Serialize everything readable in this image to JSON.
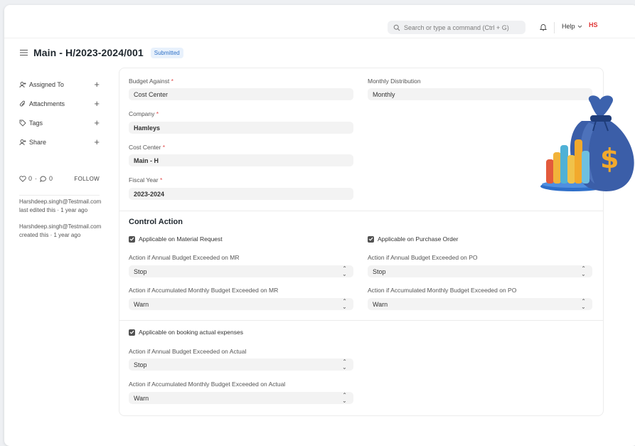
{
  "topbar": {
    "search_placeholder": "Search or type a command (Ctrl + G)",
    "help_label": "Help",
    "avatar_initials": "HS"
  },
  "page": {
    "title": "Main - H/2023-2024/001",
    "status_badge": "Submitted"
  },
  "sidebar": {
    "items": [
      {
        "label": "Assigned To",
        "icon": "user-plus-icon"
      },
      {
        "label": "Attachments",
        "icon": "paperclip-icon"
      },
      {
        "label": "Tags",
        "icon": "tag-icon"
      },
      {
        "label": "Share",
        "icon": "share-user-icon"
      }
    ],
    "likes": "0",
    "comments": "0",
    "separator": "·",
    "follow_label": "FOLLOW",
    "activity": [
      {
        "user": "Harshdeep.singh@Testmail.com",
        "text": "last edited this · 1 year ago"
      },
      {
        "user": "Harshdeep.singh@Testmail.com",
        "text": "created this · 1 year ago"
      }
    ]
  },
  "form": {
    "budget_against": {
      "label": "Budget Against",
      "value": "Cost Center"
    },
    "company": {
      "label": "Company",
      "value": "Hamleys"
    },
    "cost_center": {
      "label": "Cost Center",
      "value": "Main - H"
    },
    "fiscal_year": {
      "label": "Fiscal Year",
      "value": "2023-2024"
    },
    "monthly_distribution": {
      "label": "Monthly Distribution",
      "value": "Monthly"
    },
    "required_mark": "*",
    "control_action": {
      "title": "Control Action",
      "applicable_mr": "Applicable on Material Request",
      "applicable_po": "Applicable on Purchase Order",
      "annual_mr": {
        "label": "Action if Annual Budget Exceeded on MR",
        "value": "Stop"
      },
      "monthly_mr": {
        "label": "Action if Accumulated Monthly Budget Exceeded on MR",
        "value": "Warn"
      },
      "annual_po": {
        "label": "Action if Annual Budget Exceeded on PO",
        "value": "Stop"
      },
      "monthly_po": {
        "label": "Action if Accumulated Monthly Budget Exceeded on PO",
        "value": "Warn"
      },
      "applicable_actual": "Applicable on booking actual expenses",
      "annual_actual": {
        "label": "Action if Annual Budget Exceeded on Actual",
        "value": "Stop"
      },
      "monthly_actual": {
        "label": "Action if Accumulated Monthly Budget Exceeded on Actual",
        "value": "Warn"
      }
    }
  },
  "colors": {
    "accent": "#2f71c7",
    "required": "#e24c4c",
    "avatar": "#e03636"
  }
}
